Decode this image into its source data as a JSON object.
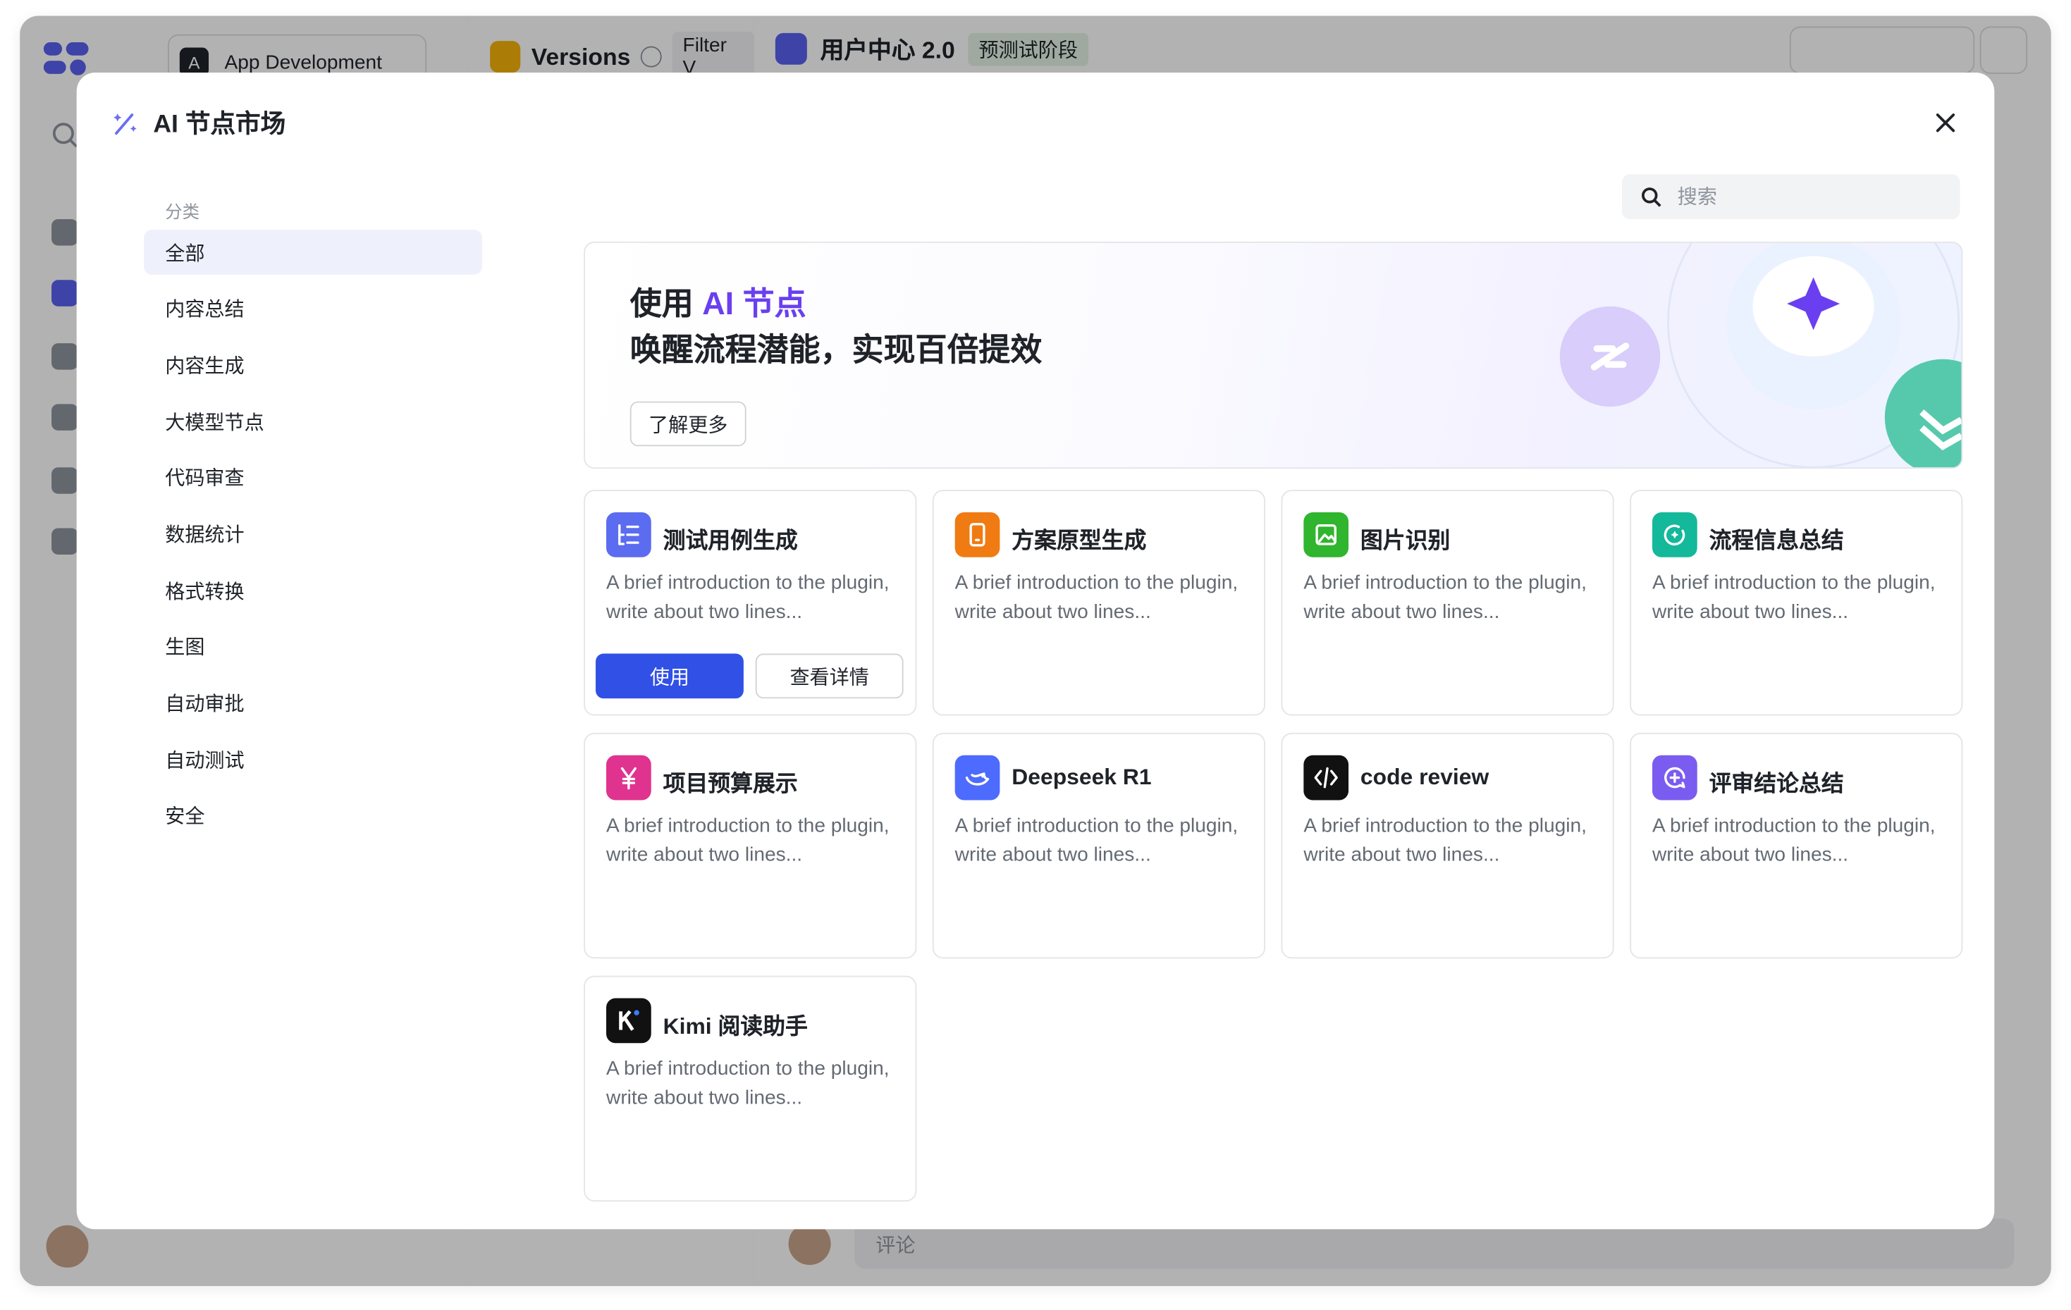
{
  "background": {
    "workspace": {
      "avatar_letter": "A",
      "name": "App Development"
    },
    "versions": {
      "title": "Versions",
      "filter": "Filter V"
    },
    "doc": {
      "title": "用户中心 2.0",
      "badge": "预测试阶段"
    },
    "comment_placeholder": "评论"
  },
  "modal": {
    "title": "AI 节点市场",
    "category_heading": "分类",
    "categories": [
      "全部",
      "内容总结",
      "内容生成",
      "大模型节点",
      "代码审查",
      "数据统计",
      "格式转换",
      "生图",
      "自动审批",
      "自动测试",
      "安全"
    ],
    "active_category": "全部",
    "search_placeholder": "搜索",
    "banner": {
      "line1_prefix": "使用 ",
      "line1_highlight": "AI 节点",
      "line2": "唤醒流程潜能，实现百倍提效",
      "button": "了解更多"
    },
    "cards": [
      {
        "title": "测试用例生成",
        "desc": "A brief introduction to the plugin, write about two lines...",
        "icon": "checklist-icon",
        "color": "#5b6cf0"
      },
      {
        "title": "方案原型生成",
        "desc": "A brief introduction to the plugin, write about two lines...",
        "icon": "phone-icon",
        "color": "#f07b12"
      },
      {
        "title": "图片识别",
        "desc": "A brief introduction to the plugin, write about two lines...",
        "icon": "image-icon",
        "color": "#2fb52e"
      },
      {
        "title": "流程信息总结",
        "desc": "A brief introduction to the plugin, write about two lines...",
        "icon": "sparkle-refresh-icon",
        "color": "#14b89a"
      },
      {
        "title": "项目预算展示",
        "desc": "A brief introduction to the plugin, write about two lines...",
        "icon": "yen-icon",
        "color": "#e0338f"
      },
      {
        "title": "Deepseek R1",
        "desc": "A brief introduction to the plugin, write about two lines...",
        "icon": "whale-icon",
        "color": "#4d6bfe"
      },
      {
        "title": "code review",
        "desc": "A brief introduction to the plugin, write about two lines...",
        "icon": "code-icon",
        "color": "#111111"
      },
      {
        "title": "评审结论总结",
        "desc": "A brief introduction to the plugin, write about two lines...",
        "icon": "chat-plus-icon",
        "color": "#7b5cf0"
      },
      {
        "title": "Kimi 阅读助手",
        "desc": "A brief introduction to the plugin, write about two lines...",
        "icon": "kimi-icon",
        "color": "#111111"
      }
    ],
    "use_label": "使用",
    "detail_label": "查看详情"
  }
}
